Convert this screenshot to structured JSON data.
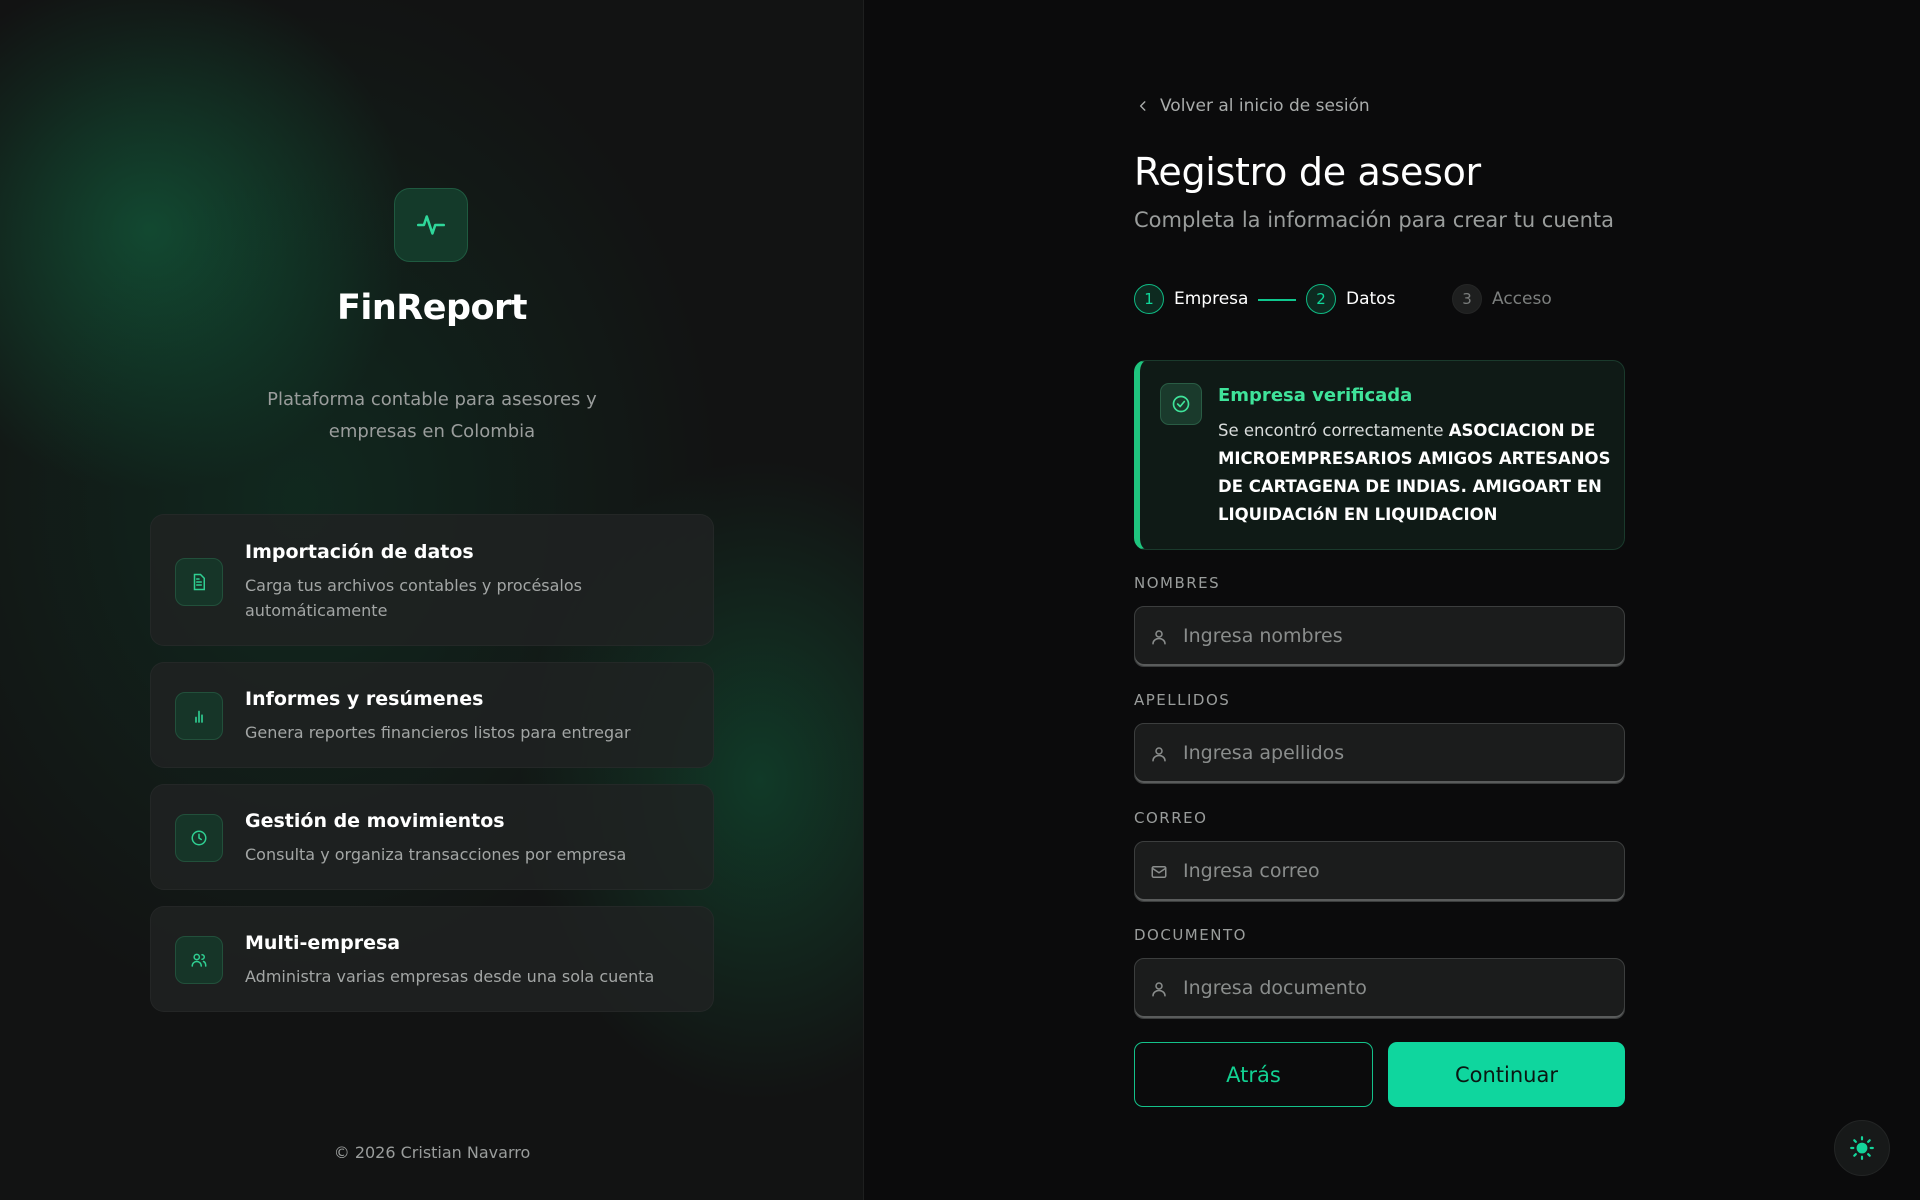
{
  "brand": {
    "name": "FinReport",
    "tagline": "Plataforma contable para asesores y empresas en Colombia",
    "logo_icon": "activity-pulse-icon"
  },
  "features": [
    {
      "icon": "file-text-icon",
      "title": "Importación de datos",
      "desc": "Carga tus archivos contables y procésalos automáticamente"
    },
    {
      "icon": "bar-chart-icon",
      "title": "Informes y resúmenes",
      "desc": "Genera reportes financieros listos para entregar"
    },
    {
      "icon": "clock-icon",
      "title": "Gestión de movimientos",
      "desc": "Consulta y organiza transacciones por empresa"
    },
    {
      "icon": "users-icon",
      "title": "Multi-empresa",
      "desc": "Administra varias empresas desde una sola cuenta"
    }
  ],
  "copyright": "© 2026 Cristian Navarro",
  "back_link": "Volver al inicio de sesión",
  "form": {
    "title": "Registro de asesor",
    "subtitle": "Completa la información para crear tu cuenta"
  },
  "steps": [
    {
      "number": "1",
      "label": "Empresa",
      "state": "active"
    },
    {
      "number": "2",
      "label": "Datos",
      "state": "active"
    },
    {
      "number": "3",
      "label": "Acceso",
      "state": "inactive"
    }
  ],
  "verified": {
    "title": "Empresa verificada",
    "text_prefix": "Se encontró correctamente",
    "company": "ASOCIACION DE MICROEMPRESARIOS AMIGOS ARTESANOS DE CARTAGENA DE INDIAS. AMIGOART EN LIQUIDACIóN EN LIQUIDACION"
  },
  "fields": {
    "nombres": {
      "label": "NOMBRES",
      "placeholder": "Ingresa nombres",
      "icon": "user-icon"
    },
    "apellidos": {
      "label": "APELLIDOS",
      "placeholder": "Ingresa apellidos",
      "icon": "user-icon"
    },
    "correo": {
      "label": "CORREO",
      "placeholder": "Ingresa correo",
      "icon": "mail-icon"
    },
    "documento": {
      "label": "DOCUMENTO",
      "placeholder": "Ingresa documento",
      "icon": "user-icon"
    }
  },
  "buttons": {
    "back": "Atrás",
    "continue": "Continuar"
  },
  "colors": {
    "accent": "#0fd69e",
    "accent_text": "#3fe39a",
    "background": "#0b0b0c"
  }
}
